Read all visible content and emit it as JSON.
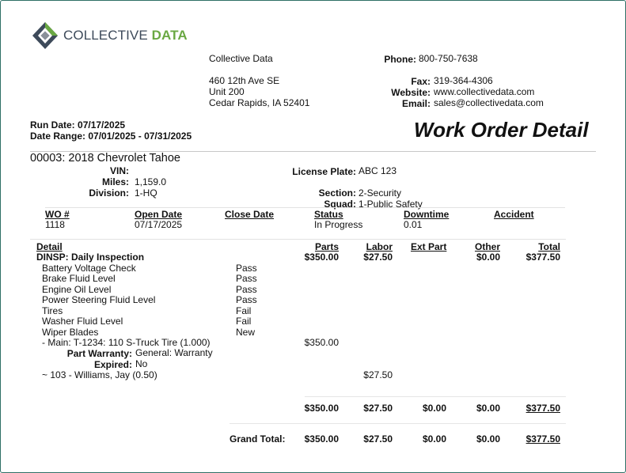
{
  "company": {
    "logo_word1": "COLLECTIVE ",
    "logo_word2": "DATA",
    "name": "Collective Data",
    "address_line1": "460 12th Ave SE",
    "address_line2": "Unit 200",
    "address_line3": "Cedar Rapids, IA 52401",
    "phone_label": "Phone:",
    "phone": "800-750-7638",
    "fax_label": "Fax:",
    "fax": "319-364-4306",
    "website_label": "Website:",
    "website": "www.collectivedata.com",
    "email_label": "Email:",
    "email": "sales@collectivedata.com",
    "colors": {
      "logo_gray": "#3d4a5a",
      "logo_green": "#6aa843",
      "frame": "#2f6f66"
    }
  },
  "report": {
    "run_date_label": "Run Date:",
    "run_date": "07/17/2025",
    "date_range_label": "Date Range:",
    "date_range": "07/01/2025 - 07/31/2025",
    "title": "Work Order Detail"
  },
  "vehicle": {
    "title": "00003: 2018 Chevrolet Tahoe",
    "vin_label": "VIN:",
    "vin": "",
    "miles_label": "Miles:",
    "miles": "1,159.0",
    "division_label": "Division:",
    "division": "1-HQ",
    "license_label": "License Plate:",
    "license": "ABC 123",
    "section_label": "Section:",
    "section": "2-Security",
    "squad_label": "Squad:",
    "squad": "1-Public Safety"
  },
  "work_order": {
    "headers": {
      "wo": "WO #",
      "open": "Open Date",
      "close": "Close Date",
      "status": "Status",
      "downtime": "Downtime",
      "accident": "Accident"
    },
    "wo": "1118",
    "open": "07/17/2025",
    "close": "",
    "status": "In Progress",
    "downtime": "0.01",
    "accident": ""
  },
  "detail": {
    "headers": {
      "detail": "Detail",
      "parts": "Parts",
      "labor": "Labor",
      "ext_part": "Ext Part",
      "other": "Other",
      "total": "Total"
    },
    "task": {
      "name": "DINSP: Daily Inspection",
      "parts": "$350.00",
      "labor": "$27.50",
      "other": "$0.00",
      "total": "$377.50"
    },
    "checks": [
      {
        "item": "Battery Voltage Check",
        "result": "Pass"
      },
      {
        "item": "Brake Fluid Level",
        "result": "Pass"
      },
      {
        "item": "Engine Oil Level",
        "result": "Pass"
      },
      {
        "item": "Power Steering Fluid Level",
        "result": "Pass"
      },
      {
        "item": "Tires",
        "result": "Fail"
      },
      {
        "item": "Washer Fluid Level",
        "result": "Fail"
      },
      {
        "item": "Wiper Blades",
        "result": "New"
      }
    ],
    "part_line": {
      "text": "- Main: T-1234: 110 S-Truck Tire (1.000)",
      "parts": "$350.00"
    },
    "warranty_label": "Part Warranty:",
    "warranty": "General: Warranty",
    "expired_label": "Expired:",
    "expired": "No",
    "labor_line": {
      "text": "~ 103 - Williams, Jay (0.50)",
      "labor": "$27.50"
    },
    "subtotal": {
      "parts": "$350.00",
      "labor": "$27.50",
      "ext_part": "$0.00",
      "other": "$0.00",
      "total": "$377.50"
    },
    "grand_total": {
      "label": "Grand Total:",
      "parts": "$350.00",
      "labor": "$27.50",
      "ext_part": "$0.00",
      "other": "$0.00",
      "total": "$377.50"
    }
  }
}
